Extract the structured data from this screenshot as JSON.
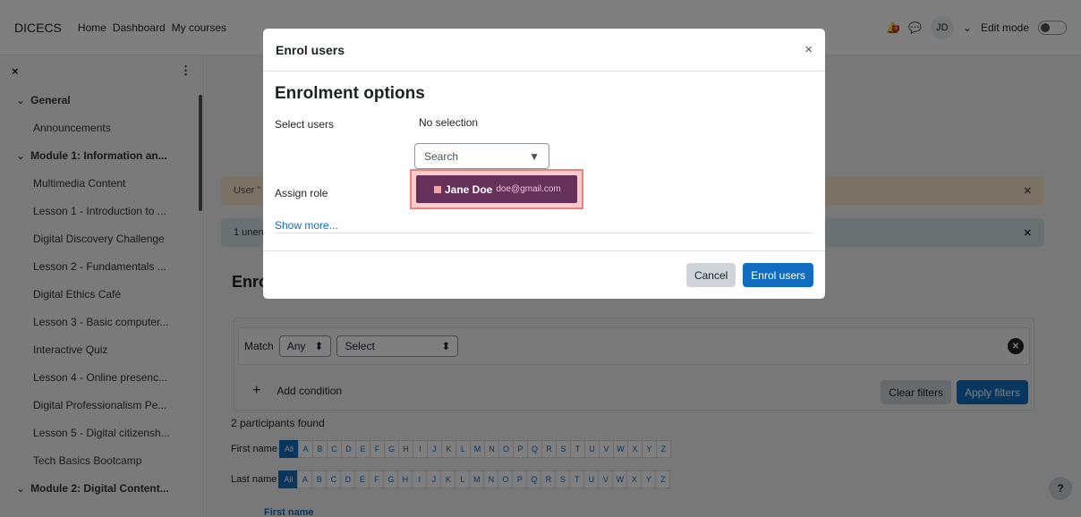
{
  "navbar": {
    "brand": "DICECS",
    "links": [
      "Home",
      "Dashboard",
      "My courses"
    ],
    "notification_count": "3",
    "user_initials": "JD",
    "edit_mode_label": "Edit mode"
  },
  "drawer": {
    "close_glyph": "×",
    "more_glyph": "⋮",
    "items": [
      {
        "label": "General",
        "type": "section"
      },
      {
        "label": "Announcements",
        "type": "item"
      },
      {
        "label": "Module 1: Information an...",
        "type": "section"
      },
      {
        "label": "Multimedia Content",
        "type": "item"
      },
      {
        "label": "Lesson 1 - Introduction to ...",
        "type": "item"
      },
      {
        "label": "Digital Discovery Challenge",
        "type": "item"
      },
      {
        "label": "Lesson 2 - Fundamentals ...",
        "type": "item"
      },
      {
        "label": "Digital Ethics Café",
        "type": "item"
      },
      {
        "label": "Lesson 3 - Basic computer...",
        "type": "item"
      },
      {
        "label": "Interactive Quiz",
        "type": "item"
      },
      {
        "label": "Lesson 4 - Online presenc...",
        "type": "item"
      },
      {
        "label": "Digital Professionalism Pe...",
        "type": "item"
      },
      {
        "label": "Lesson 5 - Digital citizensh...",
        "type": "item"
      },
      {
        "label": "Tech Basics Bootcamp",
        "type": "item"
      },
      {
        "label": "Module 2: Digital Content...",
        "type": "section"
      }
    ]
  },
  "main": {
    "alert_warning_text": "User \"",
    "alert_info_text": "1 unen",
    "heading": "Enro",
    "filter": {
      "match_label": "Match",
      "match_value": "Any",
      "select_value": "Select",
      "add_condition": "Add condition",
      "clear_filters": "Clear filters",
      "apply_filters": "Apply filters"
    },
    "participants_found": "2 participants found",
    "first_name_label": "First name",
    "last_name_label": "Last name",
    "all_label": "All",
    "letters": [
      "A",
      "B",
      "C",
      "D",
      "E",
      "F",
      "G",
      "H",
      "I",
      "J",
      "K",
      "L",
      "M",
      "N",
      "O",
      "P",
      "Q",
      "R",
      "S",
      "T",
      "U",
      "V",
      "W",
      "X",
      "Y",
      "Z"
    ],
    "help": "?",
    "column_first_name": "First name"
  },
  "modal": {
    "title": "Enrol users",
    "close_glyph": "×",
    "section_title": "Enrolment options",
    "select_users_label": "Select users",
    "no_selection": "No selection",
    "search_placeholder": "Search",
    "assign_role_label": "Assign role",
    "suggestion": {
      "name": "Jane Doe",
      "email": "doe@gmail.com"
    },
    "show_more": "Show more...",
    "cancel": "Cancel",
    "enrol_users": "Enrol users"
  }
}
